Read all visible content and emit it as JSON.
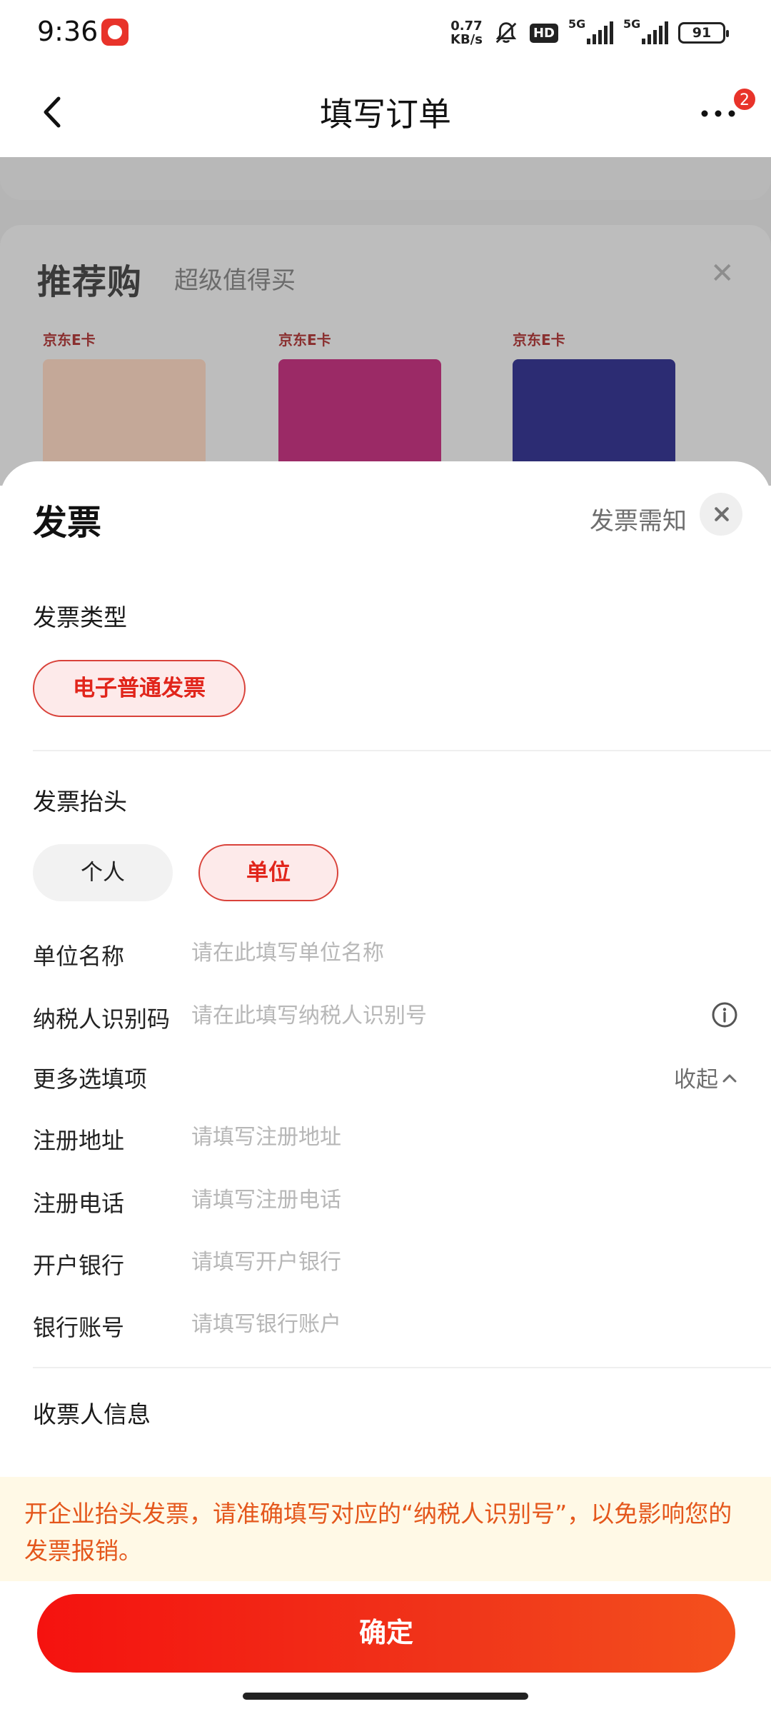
{
  "status_bar": {
    "time": "9:36",
    "net_speed_value": "0.77",
    "net_speed_unit": "KB/s",
    "hd_label": "HD",
    "signal1_label": "5G",
    "signal2_label": "5G",
    "battery": "91"
  },
  "nav": {
    "title": "填写订单",
    "more_badge": "2"
  },
  "background": {
    "recommend_title": "推荐购",
    "recommend_subtitle": "超级值得买",
    "cards": [
      {
        "label": "京东E卡",
        "color": "#c9a28a"
      },
      {
        "label": "京东E卡",
        "color": "#b8246e"
      },
      {
        "label": "京东E卡",
        "color": "#2a2a7a"
      }
    ]
  },
  "sheet": {
    "title": "发票",
    "notice_link": "发票需知",
    "invoice_type": {
      "label": "发票类型",
      "selected": "电子普通发票"
    },
    "invoice_header": {
      "label": "发票抬头",
      "options": [
        "个人",
        "单位"
      ],
      "selected": "单位"
    },
    "fields": {
      "company_name": {
        "label": "单位名称",
        "placeholder": "请在此填写单位名称"
      },
      "tax_id": {
        "label": "纳税人识别码",
        "placeholder": "请在此填写纳税人识别号"
      },
      "more_options": {
        "label": "更多选填项",
        "toggle": "收起"
      },
      "reg_address": {
        "label": "注册地址",
        "placeholder": "请填写注册地址"
      },
      "reg_phone": {
        "label": "注册电话",
        "placeholder": "请填写注册电话"
      },
      "bank": {
        "label": "开户银行",
        "placeholder": "请填写开户银行"
      },
      "bank_account": {
        "label": "银行账号",
        "placeholder": "请填写银行账户"
      }
    },
    "recipient_label": "收票人信息",
    "warning": "开企业抬头发票，请准确填写对应的“纳税人识别号”，以免影响您的发票报销。",
    "confirm_button": "确定"
  },
  "colors": {
    "accent": "#e1251b",
    "warning_text": "#e4571c",
    "warning_bg": "#fff9e6"
  }
}
